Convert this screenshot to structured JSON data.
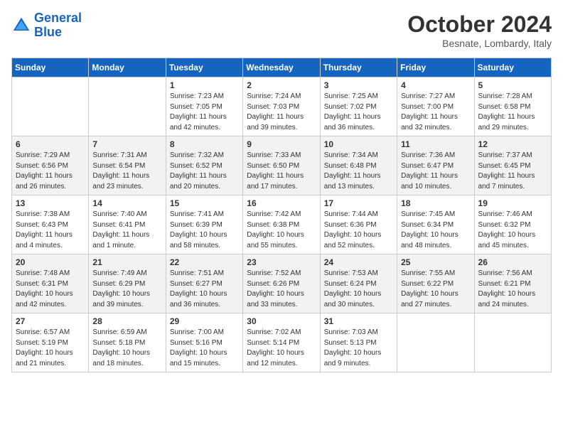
{
  "header": {
    "logo_line1": "General",
    "logo_line2": "Blue",
    "month": "October 2024",
    "location": "Besnate, Lombardy, Italy"
  },
  "days_of_week": [
    "Sunday",
    "Monday",
    "Tuesday",
    "Wednesday",
    "Thursday",
    "Friday",
    "Saturday"
  ],
  "weeks": [
    [
      {
        "day": "",
        "info": ""
      },
      {
        "day": "",
        "info": ""
      },
      {
        "day": "1",
        "info": "Sunrise: 7:23 AM\nSunset: 7:05 PM\nDaylight: 11 hours and 42 minutes."
      },
      {
        "day": "2",
        "info": "Sunrise: 7:24 AM\nSunset: 7:03 PM\nDaylight: 11 hours and 39 minutes."
      },
      {
        "day": "3",
        "info": "Sunrise: 7:25 AM\nSunset: 7:02 PM\nDaylight: 11 hours and 36 minutes."
      },
      {
        "day": "4",
        "info": "Sunrise: 7:27 AM\nSunset: 7:00 PM\nDaylight: 11 hours and 32 minutes."
      },
      {
        "day": "5",
        "info": "Sunrise: 7:28 AM\nSunset: 6:58 PM\nDaylight: 11 hours and 29 minutes."
      }
    ],
    [
      {
        "day": "6",
        "info": "Sunrise: 7:29 AM\nSunset: 6:56 PM\nDaylight: 11 hours and 26 minutes."
      },
      {
        "day": "7",
        "info": "Sunrise: 7:31 AM\nSunset: 6:54 PM\nDaylight: 11 hours and 23 minutes."
      },
      {
        "day": "8",
        "info": "Sunrise: 7:32 AM\nSunset: 6:52 PM\nDaylight: 11 hours and 20 minutes."
      },
      {
        "day": "9",
        "info": "Sunrise: 7:33 AM\nSunset: 6:50 PM\nDaylight: 11 hours and 17 minutes."
      },
      {
        "day": "10",
        "info": "Sunrise: 7:34 AM\nSunset: 6:48 PM\nDaylight: 11 hours and 13 minutes."
      },
      {
        "day": "11",
        "info": "Sunrise: 7:36 AM\nSunset: 6:47 PM\nDaylight: 11 hours and 10 minutes."
      },
      {
        "day": "12",
        "info": "Sunrise: 7:37 AM\nSunset: 6:45 PM\nDaylight: 11 hours and 7 minutes."
      }
    ],
    [
      {
        "day": "13",
        "info": "Sunrise: 7:38 AM\nSunset: 6:43 PM\nDaylight: 11 hours and 4 minutes."
      },
      {
        "day": "14",
        "info": "Sunrise: 7:40 AM\nSunset: 6:41 PM\nDaylight: 11 hours and 1 minute."
      },
      {
        "day": "15",
        "info": "Sunrise: 7:41 AM\nSunset: 6:39 PM\nDaylight: 10 hours and 58 minutes."
      },
      {
        "day": "16",
        "info": "Sunrise: 7:42 AM\nSunset: 6:38 PM\nDaylight: 10 hours and 55 minutes."
      },
      {
        "day": "17",
        "info": "Sunrise: 7:44 AM\nSunset: 6:36 PM\nDaylight: 10 hours and 52 minutes."
      },
      {
        "day": "18",
        "info": "Sunrise: 7:45 AM\nSunset: 6:34 PM\nDaylight: 10 hours and 48 minutes."
      },
      {
        "day": "19",
        "info": "Sunrise: 7:46 AM\nSunset: 6:32 PM\nDaylight: 10 hours and 45 minutes."
      }
    ],
    [
      {
        "day": "20",
        "info": "Sunrise: 7:48 AM\nSunset: 6:31 PM\nDaylight: 10 hours and 42 minutes."
      },
      {
        "day": "21",
        "info": "Sunrise: 7:49 AM\nSunset: 6:29 PM\nDaylight: 10 hours and 39 minutes."
      },
      {
        "day": "22",
        "info": "Sunrise: 7:51 AM\nSunset: 6:27 PM\nDaylight: 10 hours and 36 minutes."
      },
      {
        "day": "23",
        "info": "Sunrise: 7:52 AM\nSunset: 6:26 PM\nDaylight: 10 hours and 33 minutes."
      },
      {
        "day": "24",
        "info": "Sunrise: 7:53 AM\nSunset: 6:24 PM\nDaylight: 10 hours and 30 minutes."
      },
      {
        "day": "25",
        "info": "Sunrise: 7:55 AM\nSunset: 6:22 PM\nDaylight: 10 hours and 27 minutes."
      },
      {
        "day": "26",
        "info": "Sunrise: 7:56 AM\nSunset: 6:21 PM\nDaylight: 10 hours and 24 minutes."
      }
    ],
    [
      {
        "day": "27",
        "info": "Sunrise: 6:57 AM\nSunset: 5:19 PM\nDaylight: 10 hours and 21 minutes."
      },
      {
        "day": "28",
        "info": "Sunrise: 6:59 AM\nSunset: 5:18 PM\nDaylight: 10 hours and 18 minutes."
      },
      {
        "day": "29",
        "info": "Sunrise: 7:00 AM\nSunset: 5:16 PM\nDaylight: 10 hours and 15 minutes."
      },
      {
        "day": "30",
        "info": "Sunrise: 7:02 AM\nSunset: 5:14 PM\nDaylight: 10 hours and 12 minutes."
      },
      {
        "day": "31",
        "info": "Sunrise: 7:03 AM\nSunset: 5:13 PM\nDaylight: 10 hours and 9 minutes."
      },
      {
        "day": "",
        "info": ""
      },
      {
        "day": "",
        "info": ""
      }
    ]
  ]
}
